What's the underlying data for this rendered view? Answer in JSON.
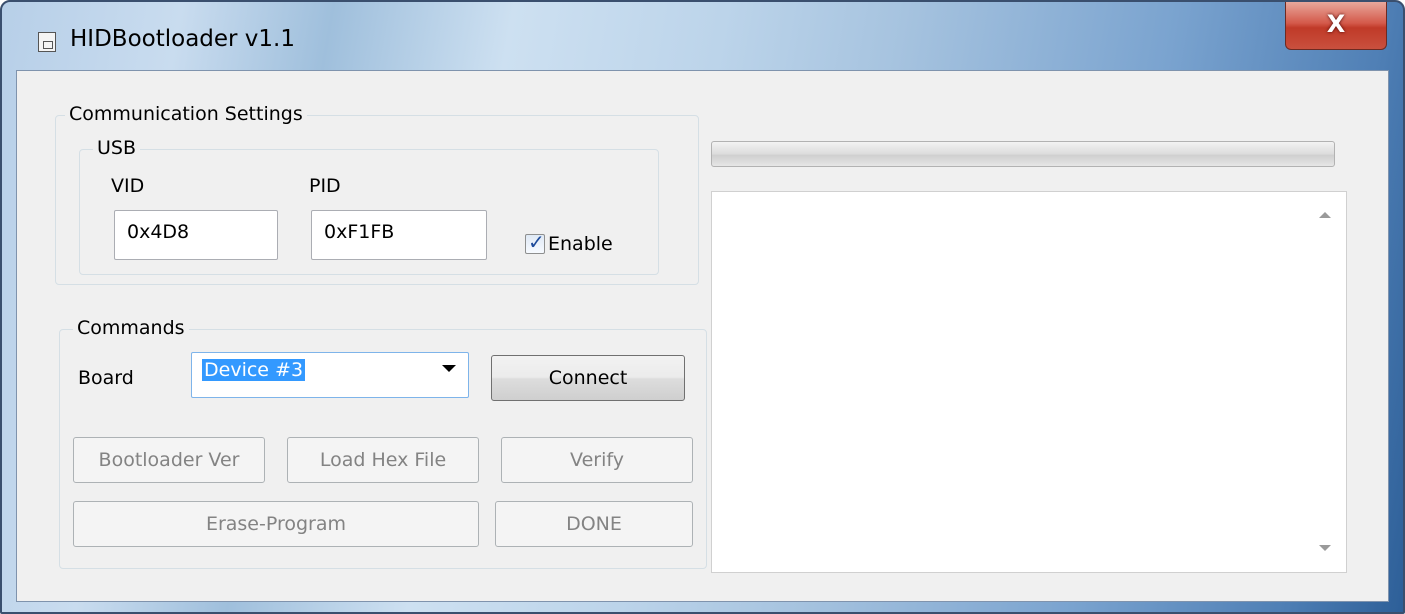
{
  "window": {
    "title": "HIDBootloader v1.1",
    "close_label": "X"
  },
  "communication": {
    "legend": "Communication Settings",
    "usb": {
      "legend": "USB",
      "vid_label": "VID",
      "vid_value": "0x4D8",
      "pid_label": "PID",
      "pid_value": "0xF1FB",
      "enable_label": "Enable",
      "enable_checked": true
    }
  },
  "commands": {
    "legend": "Commands",
    "board_label": "Board",
    "board_selected": "Device #3",
    "connect_label": "Connect",
    "bootloader_ver_label": "Bootloader Ver",
    "load_hex_label": "Load Hex File",
    "verify_label": "Verify",
    "erase_program_label": "Erase-Program",
    "done_label": "DONE"
  },
  "progress": {
    "value": 0
  },
  "log": {
    "text": ""
  },
  "icons": {
    "app": "document-icon",
    "close": "close-icon",
    "check": "checkmark-icon",
    "dropdown": "chevron-down-icon",
    "scroll_up": "scroll-up-icon",
    "scroll_down": "scroll-down-icon"
  }
}
